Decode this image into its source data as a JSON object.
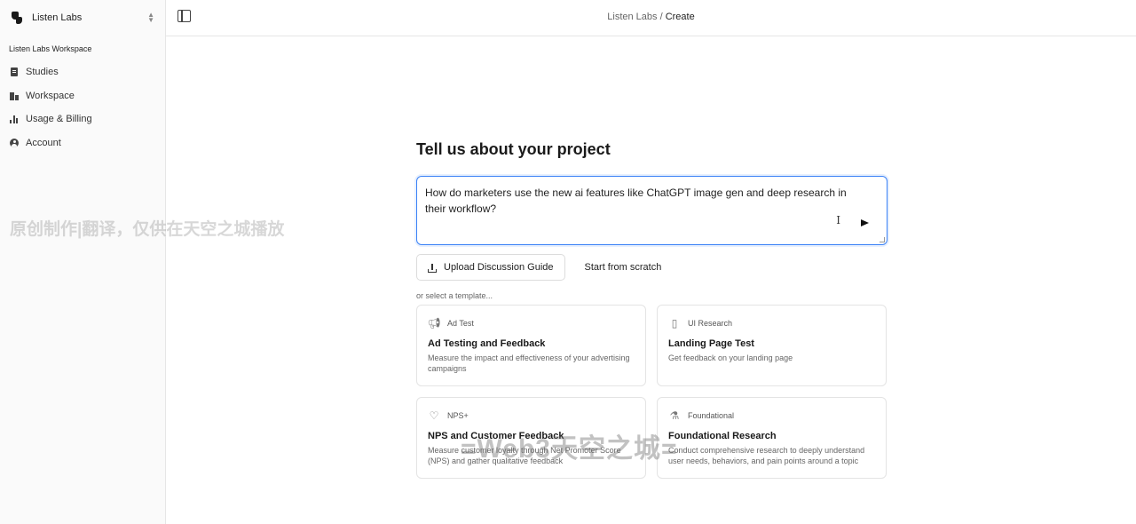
{
  "sidebar": {
    "org_name": "Listen Labs",
    "workspace_label": "Listen Labs Workspace",
    "items": [
      {
        "label": "Studies",
        "icon": "document-icon"
      },
      {
        "label": "Workspace",
        "icon": "building-icon"
      },
      {
        "label": "Usage & Billing",
        "icon": "bar-chart-icon"
      },
      {
        "label": "Account",
        "icon": "user-circle-icon"
      }
    ]
  },
  "header": {
    "breadcrumb_root": "Listen Labs /",
    "breadcrumb_current": "Create"
  },
  "main": {
    "heading": "Tell us about your project",
    "prompt_value": "How do marketers use the new ai features like ChatGPT image gen and deep research in their workflow?",
    "upload_label": "Upload Discussion Guide",
    "scratch_label": "Start from scratch",
    "select_label": "or select a template...",
    "templates": [
      {
        "tag": "Ad Test",
        "icon": "megaphone-icon",
        "title": "Ad Testing and Feedback",
        "desc": "Measure the impact and effectiveness of your advertising campaigns"
      },
      {
        "tag": "UI Research",
        "icon": "phone-icon",
        "title": "Landing Page Test",
        "desc": "Get feedback on your landing page"
      },
      {
        "tag": "NPS+",
        "icon": "heart-icon",
        "title": "NPS and Customer Feedback",
        "desc": "Measure customer loyalty through Net Promoter Score (NPS) and gather qualitative feedback"
      },
      {
        "tag": "Foundational",
        "icon": "flask-icon",
        "title": "Foundational Research",
        "desc": "Conduct comprehensive research to deeply understand user needs, behaviors, and pain points around a topic"
      }
    ]
  },
  "overlays": {
    "watermark": "原创制作|翻译，仅供在天空之城播放",
    "caption": "=Web3天空之城="
  }
}
